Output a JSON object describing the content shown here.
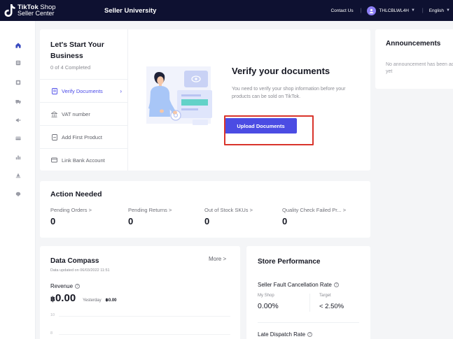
{
  "topbar": {
    "brand_bold": "TikTok",
    "brand_light": "Shop",
    "brand_sub": "Seller Center",
    "nav_title": "Seller University",
    "contact": "Contact Us",
    "account": "THLCBLWL4H",
    "language": "English"
  },
  "sidebar": {
    "icons": [
      "home-icon",
      "orders-icon",
      "products-icon",
      "shipping-icon",
      "marketing-icon",
      "finance-icon",
      "analytics-icon",
      "growth-icon",
      "service-icon"
    ]
  },
  "setup": {
    "title": "Let's Start Your Business",
    "progress": "0 of 4 Completed",
    "steps": [
      {
        "label": "Verify Documents",
        "icon": "document-icon",
        "active": true
      },
      {
        "label": "VAT number",
        "icon": "building-icon",
        "active": false
      },
      {
        "label": "Add First Product",
        "icon": "product-icon",
        "active": false
      },
      {
        "label": "Link Bank Account",
        "icon": "bank-card-icon",
        "active": false
      }
    ],
    "verify_title": "Verify your documents",
    "verify_desc": "You need to verify your shop information before your products can be sold on TikTok.",
    "upload_button": "Upload Documents"
  },
  "announcements": {
    "title": "Announcements",
    "empty_text": "No announcement has been added yet"
  },
  "action_needed": {
    "title": "Action Needed",
    "metrics": [
      {
        "label": "Pending Orders >",
        "value": "0"
      },
      {
        "label": "Pending Returns >",
        "value": "0"
      },
      {
        "label": "Out of Stock SKUs >",
        "value": "0"
      },
      {
        "label": "Quality Check Failed Pr... >",
        "value": "0"
      }
    ]
  },
  "data_compass": {
    "title": "Data Compass",
    "more": "More >",
    "updated": "Data updated on 06/03/2022 11:51",
    "revenue_label": "Revenue",
    "currency": "฿",
    "revenue_value": "0.00",
    "yesterday_label": "Yesterday",
    "yesterday_value": "฿0.00",
    "axis_labels": [
      "10",
      "8"
    ]
  },
  "store_performance": {
    "title": "Store Performance",
    "metric1_title": "Seller Fault Cancellation Rate",
    "my_shop_label": "My Shop",
    "target_label": "Target",
    "my_shop_value": "0.00%",
    "target_value": "< 2.50%",
    "metric2_title": "Late Dispatch Rate"
  },
  "colors": {
    "topbar": "#0e1131",
    "accent": "#4b4ce3",
    "highlight": "#d9342b"
  }
}
